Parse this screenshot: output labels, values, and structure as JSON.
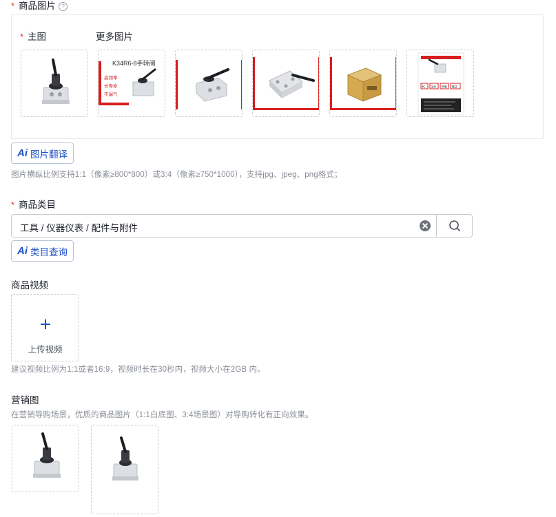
{
  "images": {
    "title": "商品图片",
    "help_icon": "question-circle-icon",
    "main_label": "主图",
    "more_label": "更多图片",
    "ai_translate": "图片翻译",
    "ai_mark": "Ai",
    "hint": "图片横纵比例支持1:1（像素≥800*800）或3:4（像素≥750*1000），支持jpg、jpeg、png格式；"
  },
  "category": {
    "title": "商品类目",
    "value": "工具 / 仪器仪表 / 配件与附件",
    "ai_query": "类目查询",
    "ai_mark": "Ai"
  },
  "video": {
    "title": "商品视频",
    "upload_label": "上传视频",
    "hint": "建议视频比例为1:1或者16:9，视频时长在30秒内，视频大小在2GB 内。"
  },
  "marketing": {
    "title": "营销图",
    "hint": "在营销导购场景，优质的商品图片（1:1白底图、3:4场景图）对导购转化有正向效果。"
  },
  "thumbnails": {
    "ad_lines": [
      "高频率",
      "长寿命",
      "不漏气"
    ],
    "ad_header": "K34R6-8手转阀",
    "model_codes": [
      "K",
      "34",
      "R6",
      "8D"
    ]
  },
  "colors": {
    "required": "#e0322d",
    "accent": "#1e52c9",
    "border": "#c9ccd1",
    "ad_red": "#d81e1e"
  }
}
